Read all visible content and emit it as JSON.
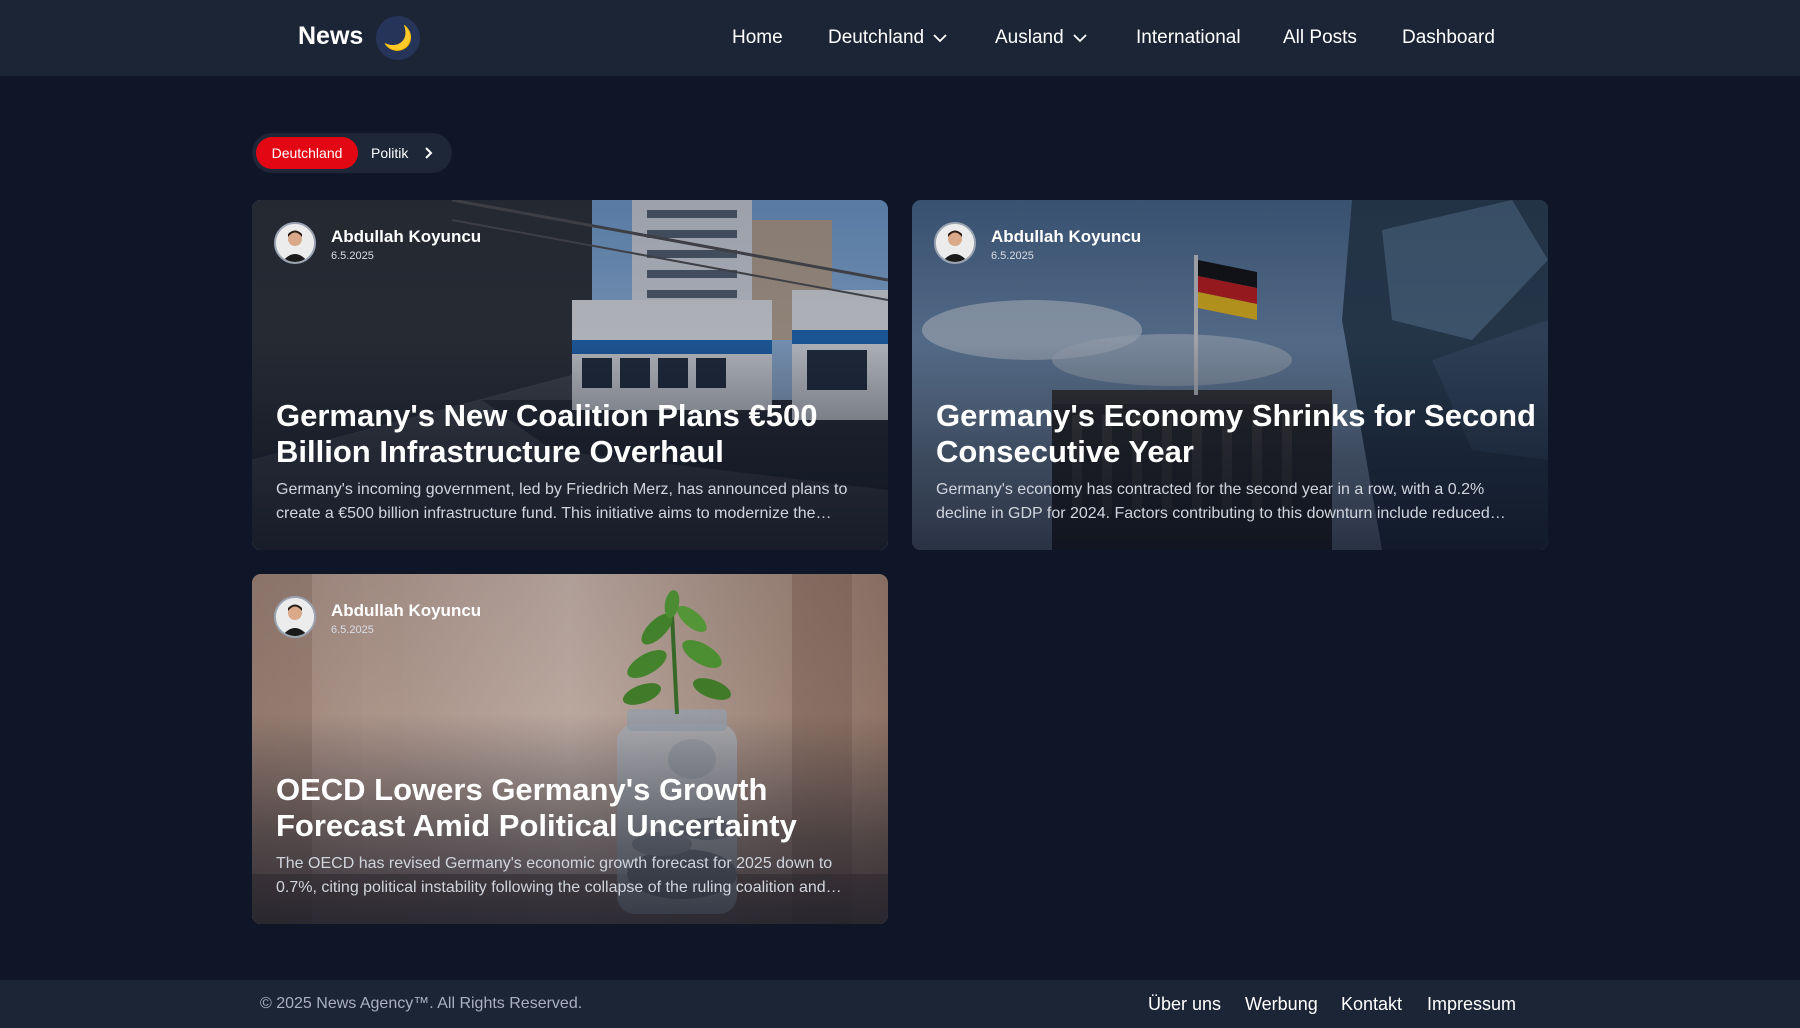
{
  "header": {
    "brand": "News",
    "theme_icon": "moon-icon",
    "nav": [
      {
        "label": "Home",
        "dropdown": false
      },
      {
        "label": "Deutchland",
        "dropdown": true
      },
      {
        "label": "Ausland",
        "dropdown": true
      },
      {
        "label": "International",
        "dropdown": false
      },
      {
        "label": "All Posts",
        "dropdown": false
      },
      {
        "label": "Dashboard",
        "dropdown": false
      }
    ]
  },
  "breadcrumb": {
    "active": "Deutchland",
    "current": "Politik"
  },
  "articles": [
    {
      "author": "Abdullah Koyuncu",
      "date": "6.5.2025",
      "title": "Germany's New Coalition Plans €500 Billion Infrastructure Overhaul",
      "excerpt": "Germany's incoming government, led by Friedrich Merz, has announced plans to create a €500 billion infrastructure fund. This initiative aims to modernize the country's railways, roads and digital networks."
    },
    {
      "author": "Abdullah Koyuncu",
      "date": "6.5.2025",
      "title": "Germany's Economy Shrinks for Second Consecutive Year",
      "excerpt": "Germany's economy has contracted for the second year in a row, with a 0.2% decline in GDP for 2024. Factors contributing to this downturn include reduced industrial output and weak exports."
    },
    {
      "author": "Abdullah Koyuncu",
      "date": "6.5.2025",
      "title": "OECD Lowers Germany's Growth Forecast Amid Political Uncertainty",
      "excerpt": "The OECD has revised Germany's economic growth forecast for 2025 down to 0.7%, citing political instability following the collapse of the ruling coalition and trade tensions."
    }
  ],
  "footer": {
    "copyright": "© 2025 News Agency™. All Rights Reserved.",
    "links": [
      "Über uns",
      "Werbung",
      "Kontakt",
      "Impressum"
    ]
  },
  "colors": {
    "page_bg": "#0f1628",
    "header_bg": "#1c2536",
    "accent": "#e30613"
  }
}
